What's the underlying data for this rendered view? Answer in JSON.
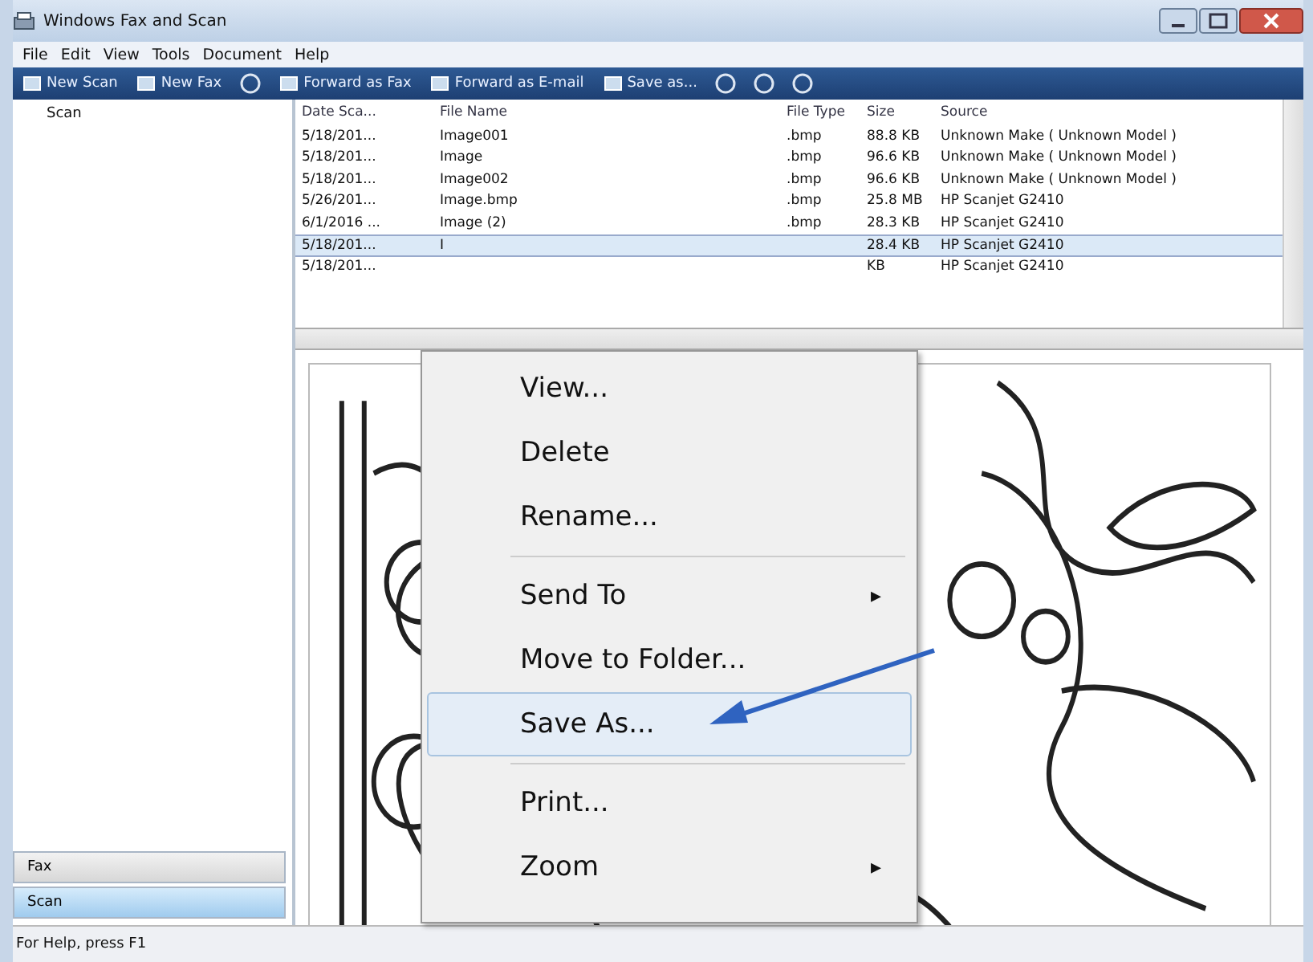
{
  "window": {
    "title": "Windows Fax and Scan"
  },
  "menu_bar": [
    "File",
    "Edit",
    "View",
    "Tools",
    "Document",
    "Help"
  ],
  "toolbar": [
    {
      "kind": "button",
      "label": "New Scan"
    },
    {
      "kind": "button",
      "label": "New Fax"
    },
    {
      "kind": "icon"
    },
    {
      "kind": "button",
      "label": "Forward as Fax"
    },
    {
      "kind": "button",
      "label": "Forward as E-mail"
    },
    {
      "kind": "button",
      "label": "Save as..."
    },
    {
      "kind": "icon"
    },
    {
      "kind": "icon"
    },
    {
      "kind": "icon"
    }
  ],
  "sidebar": {
    "tree": [
      {
        "label": "Scan",
        "selected": false
      }
    ],
    "buttons": [
      {
        "label": "Fax",
        "selected": false
      },
      {
        "label": "Scan",
        "selected": true
      }
    ]
  },
  "table": {
    "columns": [
      "Date Sca...",
      "File Name",
      "File Type",
      "Size",
      "Source"
    ],
    "rows": [
      {
        "cells": [
          "5/18/201...",
          "Image001",
          ".bmp",
          "88.8 KB",
          "Unknown Make ( Unknown Model )"
        ],
        "selected": false
      },
      {
        "cells": [
          "5/18/201...",
          "Image",
          ".bmp",
          "96.6 KB",
          "Unknown Make ( Unknown Model )"
        ],
        "selected": false
      },
      {
        "cells": [
          "5/18/201...",
          "Image002",
          ".bmp",
          "96.6 KB",
          "Unknown Make ( Unknown Model )"
        ],
        "selected": false
      },
      {
        "cells": [
          "5/26/201...",
          "Image.bmp",
          ".bmp",
          "25.8 MB",
          "HP Scanjet G2410"
        ],
        "selected": false
      },
      {
        "cells": [
          "6/1/2016 ...",
          "Image (2)",
          ".bmp",
          "28.3 KB",
          "HP Scanjet G2410"
        ],
        "selected": false
      },
      {
        "cells": [
          "5/18/201...",
          "I",
          "",
          "28.4 KB",
          "HP Scanjet G2410"
        ],
        "selected": true
      },
      {
        "cells": [
          "5/18/201...",
          "",
          "",
          "KB",
          "HP Scanjet G2410"
        ],
        "selected": false
      }
    ]
  },
  "context_menu": [
    {
      "kind": "item",
      "label": "View...",
      "selected": false
    },
    {
      "kind": "item",
      "label": "Delete",
      "selected": false
    },
    {
      "kind": "item",
      "label": "Rename...",
      "selected": false
    },
    {
      "kind": "separator"
    },
    {
      "kind": "submenu",
      "label": "Send To",
      "arrow": "▸",
      "selected": false
    },
    {
      "kind": "item",
      "label": "Move to Folder...",
      "selected": false
    },
    {
      "kind": "item",
      "label": "Save As...",
      "selected": true
    },
    {
      "kind": "separator"
    },
    {
      "kind": "item",
      "label": "Print...",
      "selected": false
    },
    {
      "kind": "submenu",
      "label": "Zoom",
      "arrow": "▸",
      "selected": false
    }
  ],
  "status_bar": "For Help, press F1"
}
